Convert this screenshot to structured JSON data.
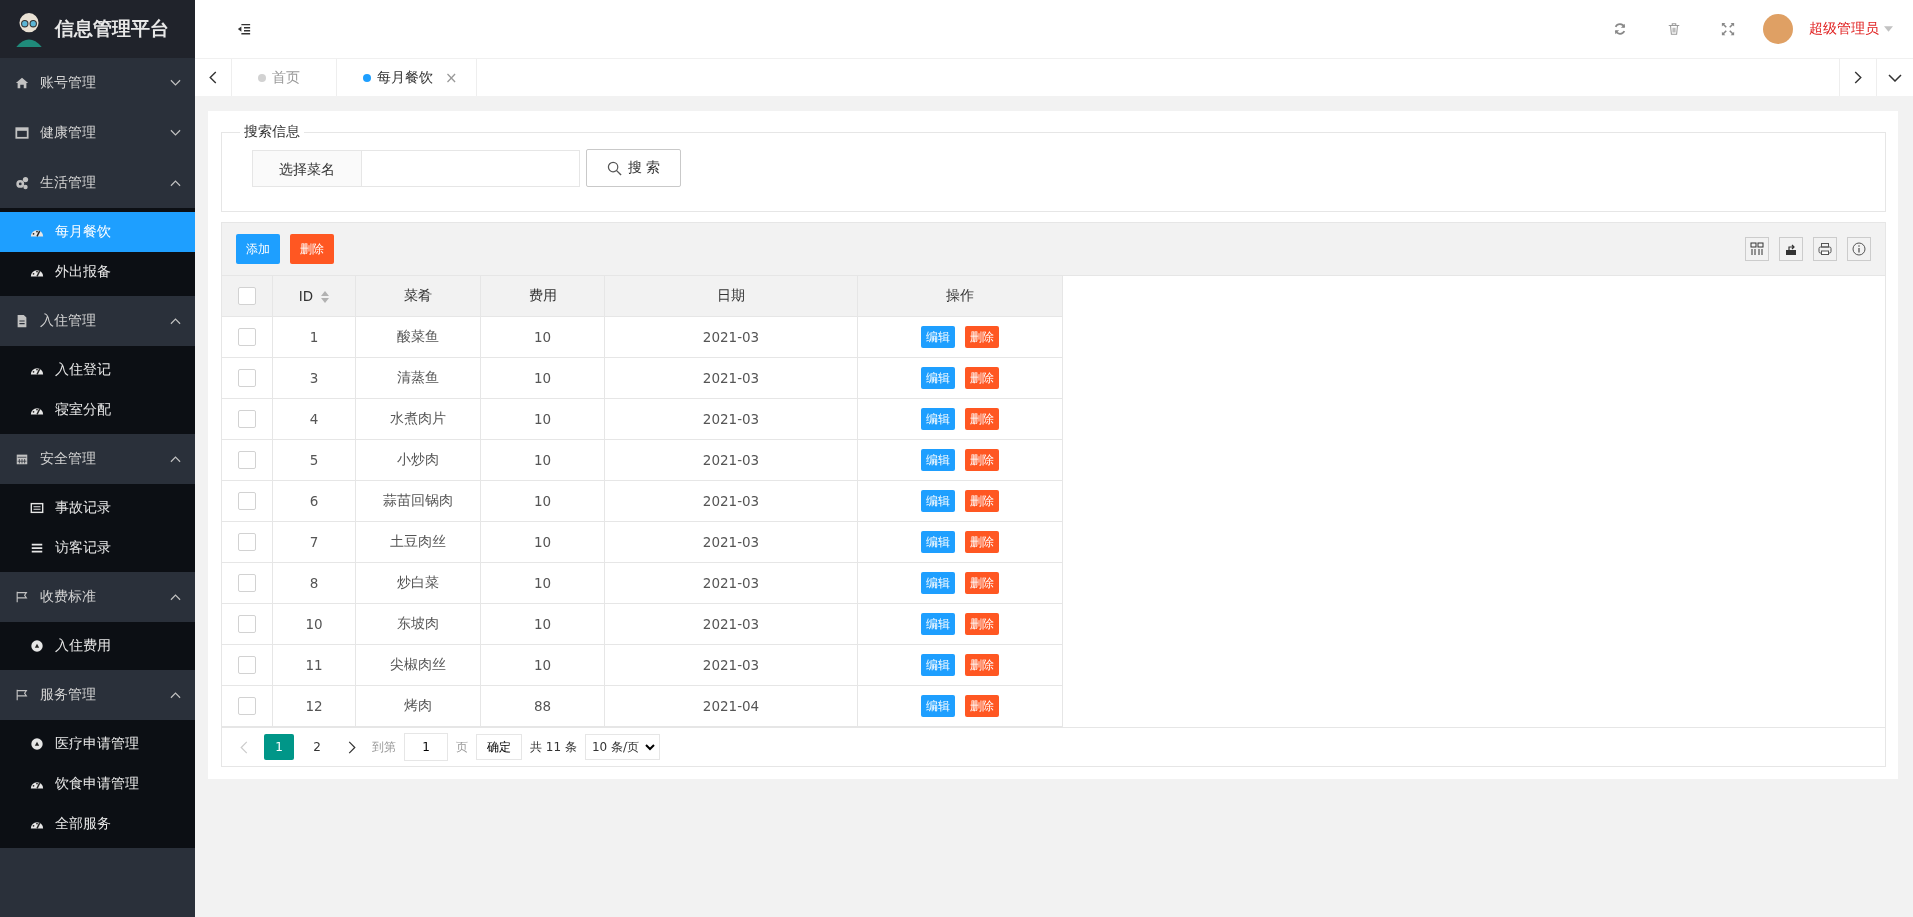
{
  "sidebar": {
    "title": "信息管理平台",
    "groups": [
      {
        "label": "账号管理",
        "expanded": false
      },
      {
        "label": "健康管理",
        "expanded": false
      },
      {
        "label": "生活管理",
        "expanded": true,
        "children": [
          {
            "label": "每月餐饮",
            "selected": true
          },
          {
            "label": "外出报备",
            "selected": false
          }
        ]
      },
      {
        "label": "入住管理",
        "expanded": true,
        "children": [
          {
            "label": "入住登记",
            "selected": false
          },
          {
            "label": "寝室分配",
            "selected": false
          }
        ]
      },
      {
        "label": "安全管理",
        "expanded": true,
        "children": [
          {
            "label": "事故记录",
            "selected": false
          },
          {
            "label": "访客记录",
            "selected": false
          }
        ]
      },
      {
        "label": "收费标准",
        "expanded": true,
        "children": [
          {
            "label": "入住费用",
            "selected": false
          }
        ]
      },
      {
        "label": "服务管理",
        "expanded": true,
        "children": [
          {
            "label": "医疗申请管理",
            "selected": false
          },
          {
            "label": "饮食申请管理",
            "selected": false
          },
          {
            "label": "全部服务",
            "selected": false
          }
        ]
      }
    ]
  },
  "header": {
    "user": "超级管理员"
  },
  "tabs": [
    {
      "label": "首页",
      "selected": false
    },
    {
      "label": "每月餐饮",
      "selected": true,
      "close": "×"
    }
  ],
  "search": {
    "legend": "搜索信息",
    "label": "选择菜名",
    "button": "搜 索"
  },
  "toolbar": {
    "add": "添加",
    "delete": "删除"
  },
  "table": {
    "select_all_checked": false,
    "columns": [
      "ID",
      "菜肴",
      "费用",
      "日期",
      "操作"
    ],
    "rows": [
      {
        "checked": false,
        "id": "1",
        "name": "酸菜鱼",
        "fee": "10",
        "date": "2021-03",
        "actions": [
          "编辑",
          "删除"
        ]
      },
      {
        "checked": false,
        "id": "3",
        "name": "清蒸鱼",
        "fee": "10",
        "date": "2021-03",
        "actions": [
          "编辑",
          "删除"
        ]
      },
      {
        "checked": false,
        "id": "4",
        "name": "水煮肉片",
        "fee": "10",
        "date": "2021-03",
        "actions": [
          "编辑",
          "删除"
        ]
      },
      {
        "checked": false,
        "id": "5",
        "name": "小炒肉",
        "fee": "10",
        "date": "2021-03",
        "actions": [
          "编辑",
          "删除"
        ]
      },
      {
        "checked": false,
        "id": "6",
        "name": "蒜苗回锅肉",
        "fee": "10",
        "date": "2021-03",
        "actions": [
          "编辑",
          "删除"
        ]
      },
      {
        "checked": false,
        "id": "7",
        "name": "土豆肉丝",
        "fee": "10",
        "date": "2021-03",
        "actions": [
          "编辑",
          "删除"
        ]
      },
      {
        "checked": false,
        "id": "8",
        "name": "炒白菜",
        "fee": "10",
        "date": "2021-03",
        "actions": [
          "编辑",
          "删除"
        ]
      },
      {
        "checked": false,
        "id": "10",
        "name": "东坡肉",
        "fee": "10",
        "date": "2021-03",
        "actions": [
          "编辑",
          "删除"
        ]
      },
      {
        "checked": false,
        "id": "11",
        "name": "尖椒肉丝",
        "fee": "10",
        "date": "2021-03",
        "actions": [
          "编辑",
          "删除"
        ]
      },
      {
        "checked": false,
        "id": "12",
        "name": "烤肉",
        "fee": "88",
        "date": "2021-04",
        "actions": [
          "编辑",
          "删除"
        ]
      }
    ]
  },
  "pagination": {
    "pages": [
      {
        "label": "1",
        "selected": true
      },
      {
        "label": "2",
        "selected": false
      }
    ],
    "goto": "到第",
    "page_value": "1",
    "page_unit": "页",
    "confirm": "确定",
    "total": "共 11 条",
    "page_size": "10 条/页"
  }
}
